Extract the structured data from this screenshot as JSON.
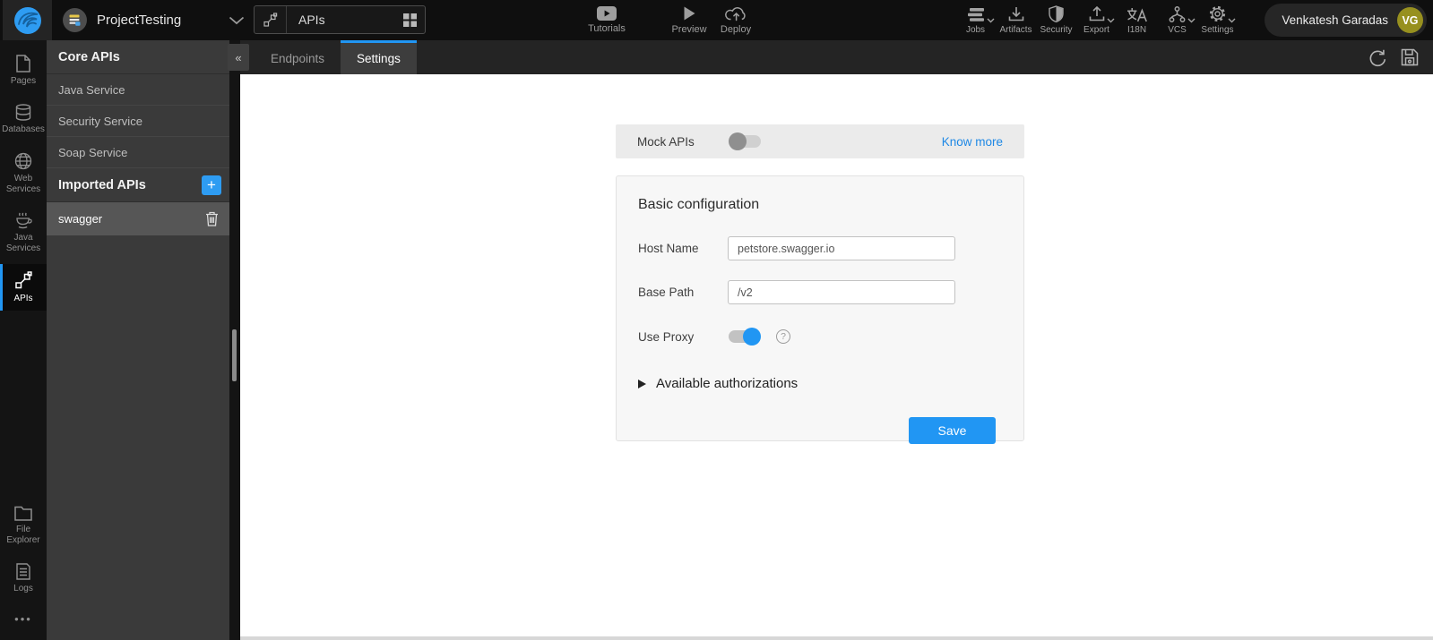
{
  "topbar": {
    "project_name": "ProjectTesting",
    "workspace_tab": {
      "label": "APIs"
    },
    "center_actions": [
      {
        "label": "Tutorials"
      },
      {
        "label": "Preview"
      },
      {
        "label": "Deploy"
      }
    ],
    "right_actions": [
      {
        "label": "Jobs",
        "has_dropdown": true
      },
      {
        "label": "Artifacts",
        "has_dropdown": false
      },
      {
        "label": "Security",
        "has_dropdown": false
      },
      {
        "label": "Export",
        "has_dropdown": true
      },
      {
        "label": "I18N",
        "has_dropdown": false
      },
      {
        "label": "VCS",
        "has_dropdown": true
      },
      {
        "label": "Settings",
        "has_dropdown": true
      }
    ],
    "user": {
      "name": "Venkatesh Garadas",
      "initials": "VG"
    }
  },
  "sidebar": {
    "items": [
      {
        "label": "Pages",
        "active": false
      },
      {
        "label": "Databases",
        "active": false
      },
      {
        "label": "Web Services",
        "active": false
      },
      {
        "label": "Java Services",
        "active": false
      },
      {
        "label": "APIs",
        "active": true
      }
    ],
    "bottom_items": [
      {
        "label": "File Explorer"
      },
      {
        "label": "Logs"
      }
    ],
    "more_glyph": "•••"
  },
  "panel": {
    "collapse_glyph": "«",
    "core_header": "Core APIs",
    "core_items": [
      "Java Service",
      "Security Service",
      "Soap Service"
    ],
    "imported_header": "Imported APIs",
    "add_glyph": "+",
    "imported_items": [
      {
        "name": "swagger",
        "selected": true
      }
    ]
  },
  "tabs": [
    {
      "label": "Endpoints",
      "active": false
    },
    {
      "label": "Settings",
      "active": true
    }
  ],
  "content": {
    "mock_row": {
      "label": "Mock APIs",
      "toggle_on": false,
      "link_label": "Know more"
    },
    "card": {
      "title": "Basic configuration",
      "fields": [
        {
          "label": "Host Name",
          "value": "petstore.swagger.io"
        },
        {
          "label": "Base Path",
          "value": "/v2"
        }
      ],
      "proxy": {
        "label": "Use Proxy",
        "toggle_on": true,
        "help_glyph": "?"
      },
      "expander": {
        "label": "Available authorizations"
      },
      "save_label": "Save"
    }
  },
  "colors": {
    "accent": "#2196f3",
    "link": "#1e88e5",
    "avatar_bg": "#97901f"
  }
}
